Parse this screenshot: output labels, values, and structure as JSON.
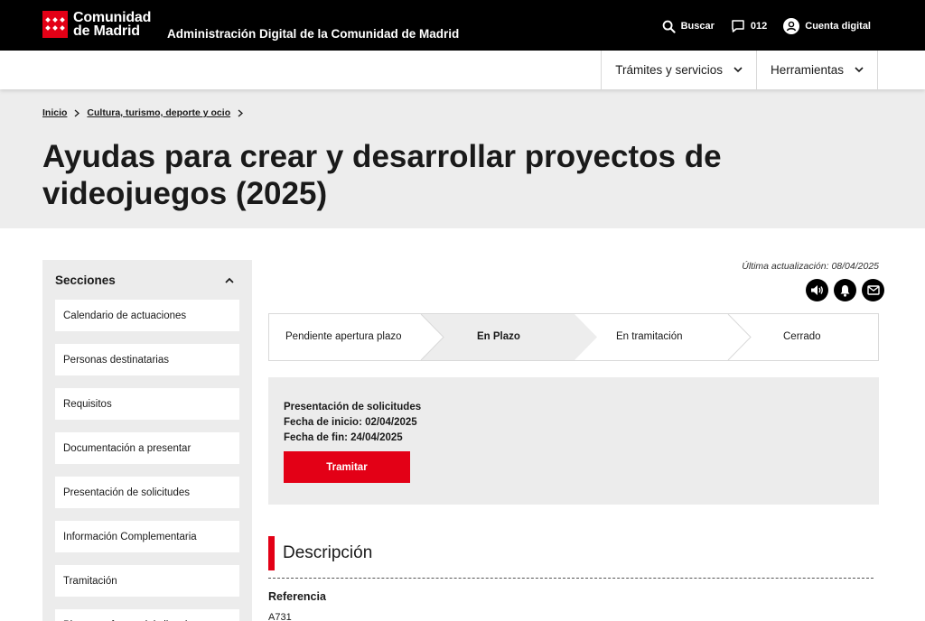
{
  "header": {
    "logo_line1": "Comunidad",
    "logo_line2": "de Madrid",
    "portal_title": "Administración Digital de la Comunidad de Madrid",
    "search_label": "Buscar",
    "phone_label": "012",
    "account_label": "Cuenta digital"
  },
  "nav": {
    "items": [
      {
        "label": "Trámites y servicios"
      },
      {
        "label": "Herramientas"
      }
    ]
  },
  "breadcrumb": {
    "items": [
      {
        "label": "Inicio"
      },
      {
        "label": "Cultura, turismo, deporte y ocio"
      }
    ]
  },
  "page": {
    "title": "Ayudas para crear y desarrollar proyectos de videojuegos (2025)",
    "updated": "Última actualización: 08/04/2025"
  },
  "sidebar": {
    "title": "Secciones",
    "items": [
      {
        "label": "Calendario de actuaciones"
      },
      {
        "label": "Personas destinatarias"
      },
      {
        "label": "Requisitos"
      },
      {
        "label": "Documentación a presentar"
      },
      {
        "label": "Presentación de solicitudes"
      },
      {
        "label": "Información Complementaria"
      },
      {
        "label": "Tramitación"
      },
      {
        "label": "Plazos y efectos del silencio"
      }
    ]
  },
  "icons": {
    "round": [
      "speaker-icon",
      "bell-icon",
      "mail-icon"
    ]
  },
  "status": {
    "steps": [
      {
        "label": "Pendiente apertura plazo",
        "active": false
      },
      {
        "label": "En Plazo",
        "active": true
      },
      {
        "label": "En tramitación",
        "active": false
      },
      {
        "label": "Cerrado",
        "active": false
      }
    ]
  },
  "application": {
    "title": "Presentación de solicitudes",
    "start": "Fecha de inicio: 02/04/2025",
    "end": "Fecha de fin: 24/04/2025",
    "button_label": "Tramitar"
  },
  "description": {
    "title": "Descripción",
    "reference_label": "Referencia",
    "reference_value": "A731"
  },
  "colors": {
    "brand_red": "#e30016",
    "header_bg": "#000000",
    "panel_gray": "#ececec",
    "active_step": "#ededed"
  }
}
